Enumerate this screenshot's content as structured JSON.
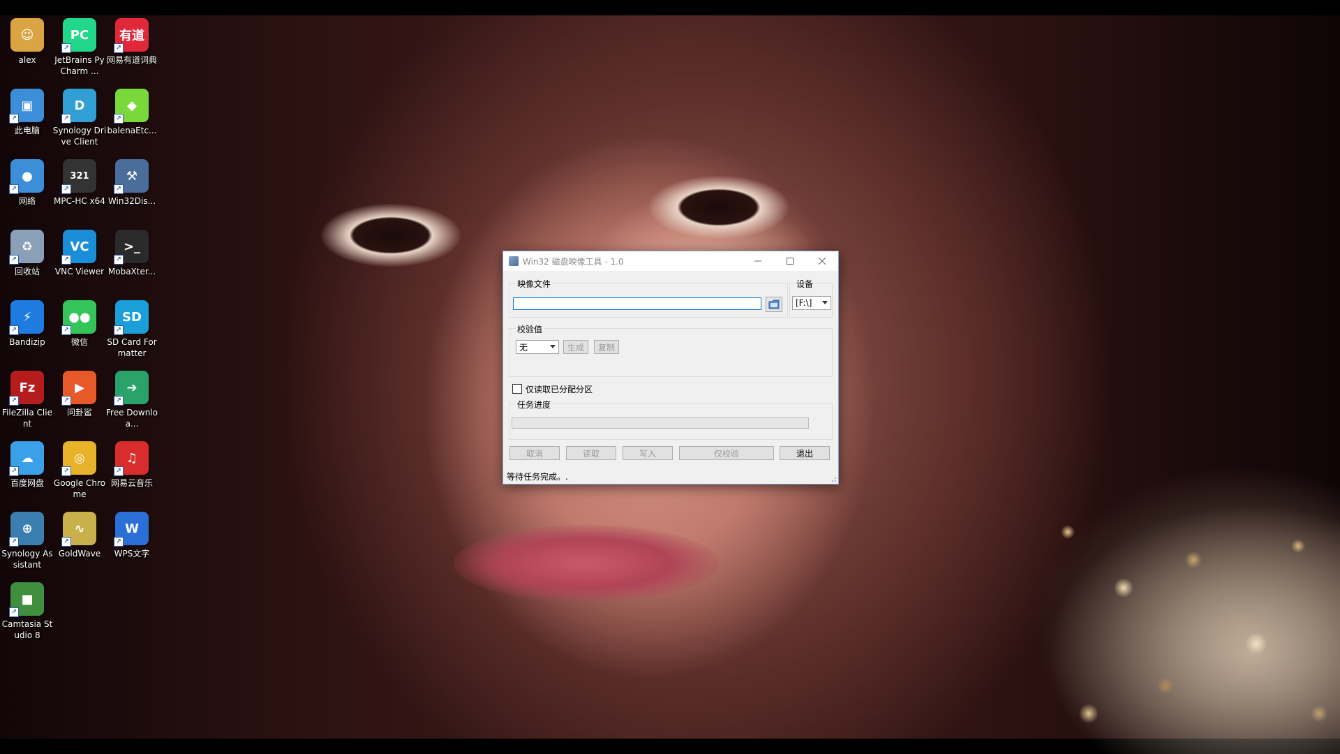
{
  "desktop": {
    "icons": [
      {
        "label": "alex",
        "icon": "user-folder-icon",
        "color": "#d9a441",
        "glyph": "☺"
      },
      {
        "label": "JetBrains PyCharm ...",
        "icon": "pycharm-icon",
        "color": "#21d789",
        "glyph": "PC"
      },
      {
        "label": "网易有道词典",
        "icon": "youdao-dict-icon",
        "color": "#e0283a",
        "glyph": "有道"
      },
      {
        "label": "此电脑",
        "icon": "this-pc-icon",
        "color": "#3c8ed8",
        "glyph": "▣"
      },
      {
        "label": "Synology Drive Client",
        "icon": "synology-drive-icon",
        "color": "#2f9fd6",
        "glyph": "D"
      },
      {
        "label": "balenaEtc...",
        "icon": "balena-etcher-icon",
        "color": "#7ad83a",
        "glyph": "◆"
      },
      {
        "label": "网络",
        "icon": "network-icon",
        "color": "#3c8ed8",
        "glyph": "●"
      },
      {
        "label": "MPC-HC x64",
        "icon": "mpc-hc-icon",
        "color": "#333333",
        "glyph": "321"
      },
      {
        "label": "Win32Dis...",
        "icon": "win32-disk-imager-icon",
        "color": "#4a6d9a",
        "glyph": "⚒"
      },
      {
        "label": "回收站",
        "icon": "recycle-bin-icon",
        "color": "#8aa0b8",
        "glyph": "♻"
      },
      {
        "label": "VNC Viewer",
        "icon": "vnc-viewer-icon",
        "color": "#1b8ed9",
        "glyph": "VC"
      },
      {
        "label": "MobaXter...",
        "icon": "mobaxterm-icon",
        "color": "#2a2a2a",
        "glyph": ">_"
      },
      {
        "label": "Bandizip",
        "icon": "bandizip-icon",
        "color": "#1e7be0",
        "glyph": "⚡"
      },
      {
        "label": "微信",
        "icon": "wechat-icon",
        "color": "#35c45a",
        "glyph": "●●"
      },
      {
        "label": "SD Card Formatter",
        "icon": "sd-card-formatter-icon",
        "color": "#1a9fd8",
        "glyph": "SD"
      },
      {
        "label": "FileZilla Client",
        "icon": "filezilla-icon",
        "color": "#b51c1c",
        "glyph": "Fz"
      },
      {
        "label": "问卦鲨",
        "icon": "media-player-icon",
        "color": "#e8592a",
        "glyph": "▶"
      },
      {
        "label": "Free Downloa...",
        "icon": "free-download-manager-icon",
        "color": "#2aa36b",
        "glyph": "➔"
      },
      {
        "label": "百度网盘",
        "icon": "baidu-netdisk-icon",
        "color": "#3aa0e8",
        "glyph": "☁"
      },
      {
        "label": "Google Chrome",
        "icon": "chrome-icon",
        "color": "#e8b22a",
        "glyph": "◎"
      },
      {
        "label": "网易云音乐",
        "icon": "netease-music-icon",
        "color": "#d92c2c",
        "glyph": "♫"
      },
      {
        "label": "Synology Assistant",
        "icon": "synology-assistant-icon",
        "color": "#3a7fb0",
        "glyph": "⊕"
      },
      {
        "label": "GoldWave",
        "icon": "goldwave-icon",
        "color": "#c8b04a",
        "glyph": "∿"
      },
      {
        "label": "WPS文字",
        "icon": "wps-writer-icon",
        "color": "#2a6fd6",
        "glyph": "W"
      },
      {
        "label": "Camtasia Studio 8",
        "icon": "camtasia-icon",
        "color": "#3f8f3f",
        "glyph": "■"
      }
    ]
  },
  "window": {
    "title": "Win32 磁盘映像工具 - 1.0",
    "image_file_label": "映像文件",
    "image_file_value": "",
    "device_label": "设备",
    "device_value": "[F:\\]",
    "hash_label": "校验值",
    "hash_type_value": "无",
    "generate_label": "生成",
    "copy_label": "复制",
    "read_only_allocated_label": "仅读取已分配分区",
    "read_only_allocated_checked": false,
    "progress_label": "任务进度",
    "progress": 0,
    "buttons": {
      "cancel": "取消",
      "read": "读取",
      "write": "写入",
      "verify_only": "仅校验",
      "exit": "退出"
    },
    "status": "等待任务完成。."
  }
}
